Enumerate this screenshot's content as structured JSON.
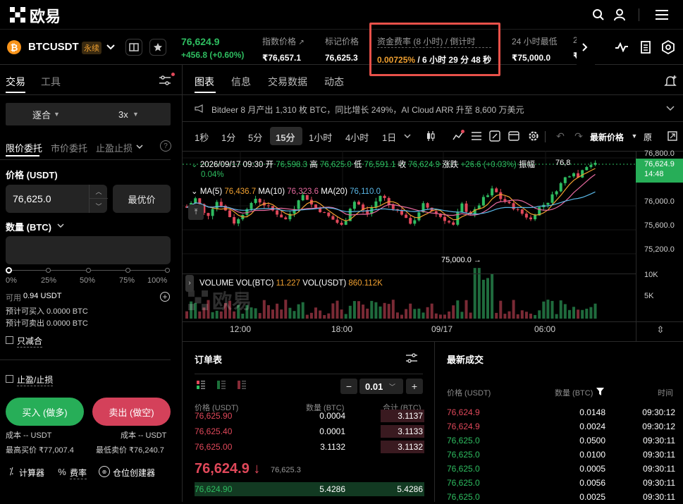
{
  "header": {
    "logo_text": "欧易"
  },
  "ticker": {
    "symbol": "BTCUSDT",
    "badge": "永续",
    "price": "76,624.9",
    "change": "+456.8 (+0.60%)",
    "index_label": "指数价格",
    "index_value": "₹76,657.1",
    "mark_label": "标记价格",
    "mark_value": "76,625.3",
    "funding_label": "资金费率 (8 小时) / 倒计时",
    "funding_rate": "0.00725%",
    "funding_countdown": " / 6 小时 29 分 48 秒",
    "low_label": "24 小时最低",
    "low_value": "₹75,000.0",
    "extra_label": "2",
    "extra_value": "₹"
  },
  "order_panel": {
    "tab_trade": "交易",
    "tab_tools": "工具",
    "margin_mode": "逐合",
    "leverage": "3x",
    "order_types": [
      "限价委托",
      "市价委托",
      "止盈止损"
    ],
    "price_label": "价格 (USDT)",
    "price_value": "76,625.0",
    "best_price": "最优价",
    "qty_label": "数量 (BTC)",
    "qty_value": "",
    "pcts": [
      "0%",
      "25%",
      "50%",
      "75%",
      "100%"
    ],
    "available_label": "可用",
    "available_value": "0.94 USDT",
    "can_buy": "预计可买入 0.0000 BTC",
    "can_sell": "预计可卖出 0.0000 BTC",
    "reduce_only": "只减合",
    "tpsl": "止盈/止损",
    "buy": "买入 (做多)",
    "sell": "卖出 (做空)",
    "cost_buy": "成本 -- USDT",
    "cost_sell": "成本 -- USDT",
    "max_buy": "最高买价 ₹77,007.4",
    "min_sell": "最低卖价 ₹76,240.7",
    "calc": "计算器",
    "fee": "费率",
    "pos": "仓位创建器"
  },
  "chart_panel": {
    "tabs": [
      "图表",
      "信息",
      "交易数据",
      "动态"
    ],
    "news": "Bitdeer 8 月产出 1,310 枚 BTC，同比增长 249%，AI Cloud ARR 升至 8,600 万美元",
    "timeframes": [
      "1秒",
      "1分",
      "5分",
      "15分",
      "1小时",
      "4小时",
      "1日"
    ],
    "active_tf": "15分",
    "latest_price_label": "最新价格",
    "orig_label": "原",
    "ohlc": {
      "date": "2026/09/17 09:30",
      "o_label": "开",
      "o": "76,598.3",
      "h_label": "高",
      "h": "76,625.0",
      "l_label": "低",
      "l": "76,591.1",
      "c_label": "收",
      "c": "76,624.9",
      "chg_label": "涨跌",
      "chg": "+26.6 (+0.03%)",
      "amp_label": "振幅",
      "amp": "0.04%"
    },
    "ma": {
      "ma5_label": "MA(5)",
      "ma5": "76,436.7",
      "ma10_label": "MA(10)",
      "ma10": "76,323.6",
      "ma20_label": "MA(20)",
      "ma20": "76,110.0"
    },
    "y_ticks": [
      "76,800.0",
      "76,000.0",
      "75,600.0",
      "75,200.0"
    ],
    "last_price": "76,624.9",
    "last_time": "14:48",
    "low_marker": "75,000.0 →",
    "high_marker": "76,8",
    "vol": {
      "label": "VOLUME",
      "btc_label": "VOL(BTC)",
      "btc": "11.227",
      "usdt_label": "VOL(USDT)",
      "usdt": "860.112K"
    },
    "vol_ticks": [
      "10K",
      "5K"
    ],
    "x_ticks": [
      "12:00",
      "18:00",
      "09/17",
      "06:00"
    ],
    "watermark": "欧易"
  },
  "orderbook": {
    "title": "订单表",
    "step": "0.01",
    "headers": [
      "价格 (USDT)",
      "数量 (BTC)",
      "合计 (BTC)"
    ],
    "asks": [
      [
        "76,625.90",
        "0.0004",
        "3.1137"
      ],
      [
        "76,625.40",
        "0.0001",
        "3.1133"
      ],
      [
        "76,625.00",
        "3.1132",
        "3.1132"
      ]
    ],
    "mid_price": "76,624.9",
    "mid_mark": "76,625.3",
    "bids": [
      [
        "76,624.90",
        "5.4286",
        "5.4286"
      ]
    ]
  },
  "trades": {
    "title": "最新成交",
    "headers": [
      "价格 (USDT)",
      "数量 (BTC)",
      "时间"
    ],
    "rows": [
      [
        "76,624.9",
        "0.0148",
        "09:30:12",
        "r"
      ],
      [
        "76,624.9",
        "0.0024",
        "09:30:12",
        "r"
      ],
      [
        "76,625.0",
        "0.0500",
        "09:30:11",
        "g"
      ],
      [
        "76,625.0",
        "0.0100",
        "09:30:11",
        "g"
      ],
      [
        "76,625.0",
        "0.0005",
        "09:30:11",
        "g"
      ],
      [
        "76,625.0",
        "0.0056",
        "09:30:11",
        "g"
      ],
      [
        "76,625.0",
        "0.0025",
        "09:30:11",
        "g"
      ]
    ]
  },
  "colors": {
    "up": "#2ebd60",
    "down": "#e0485a",
    "accent": "#f0a030",
    "highlight_box": "#e8514a"
  }
}
